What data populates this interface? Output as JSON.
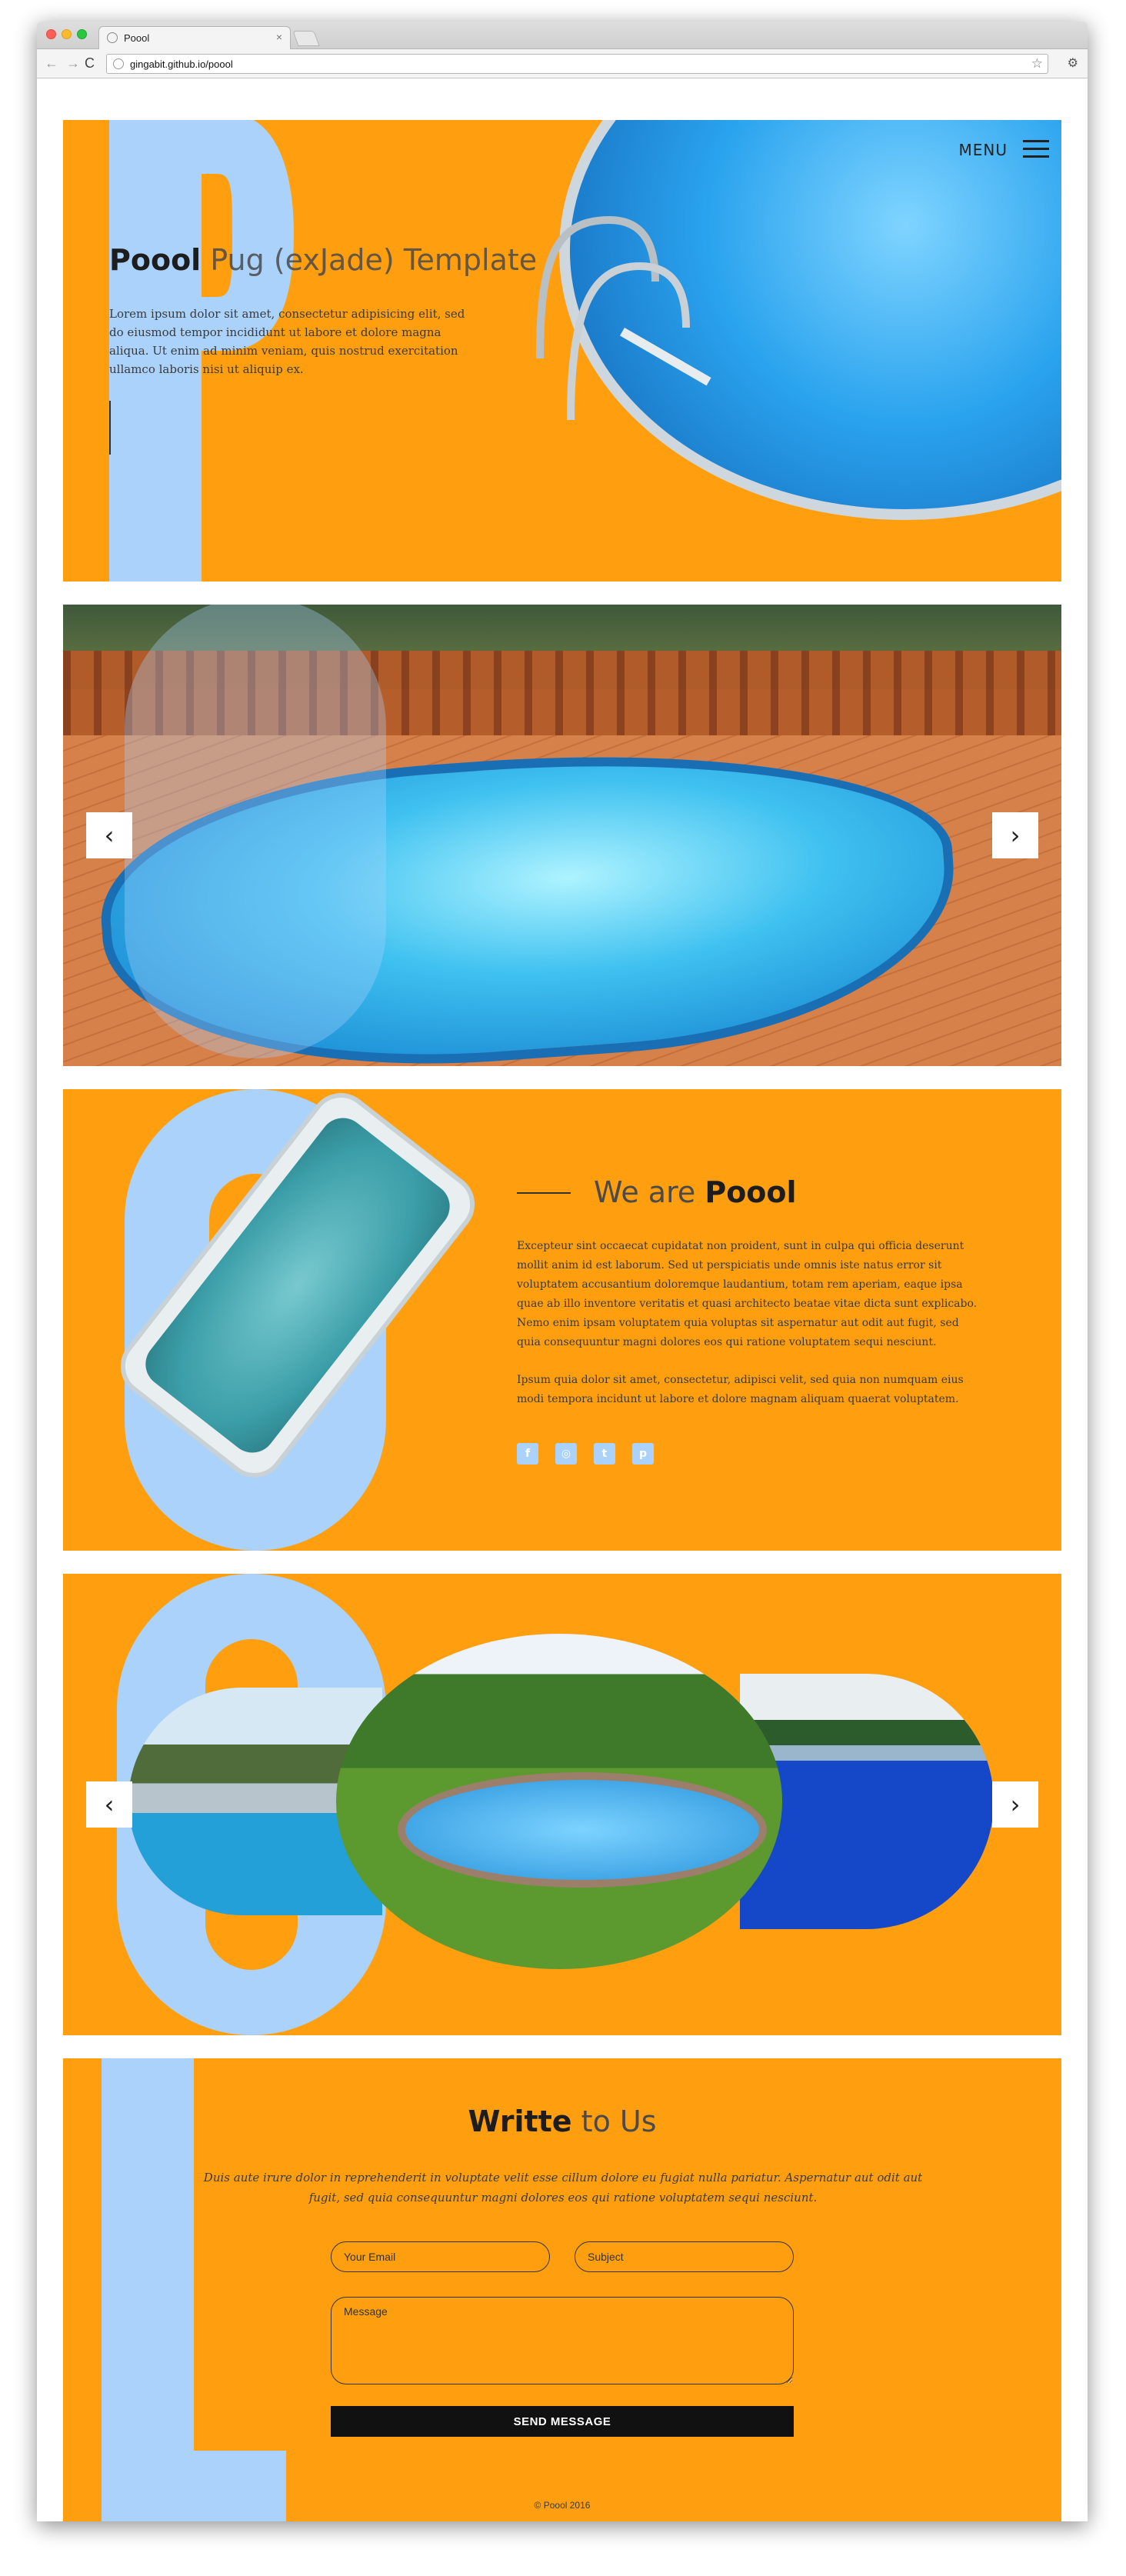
{
  "browser": {
    "tab_title": "Poool",
    "url": "gingabit.github.io/poool",
    "tab_close": "×",
    "nav": {
      "back": "←",
      "forward": "→",
      "reload": "C"
    },
    "star": "☆",
    "wrench": "🔧"
  },
  "hero": {
    "menu_label": "MENU",
    "big_letter": "P",
    "title_bold": "Poool",
    "title_light": " Pug (exJade) Template",
    "text": "Lorem ipsum dolor sit amet, consectetur adipisicing elit, sed do eiusmod tempor incididunt ut labore et dolore magna aliqua. Ut enim ad minim veniam, quis nostrud exercitation ullamco laboris nisi ut aliquip ex."
  },
  "slider": {
    "prev": "‹",
    "next": "›"
  },
  "about": {
    "title_light": "We are ",
    "title_bold": "Poool",
    "paragraph1": "Excepteur sint occaecat cupidatat non proident, sunt in culpa qui officia deserunt mollit anim id est laborum. Sed ut perspiciatis unde omnis iste natus error sit voluptatem accusantium doloremque laudantium, totam rem aperiam, eaque ipsa quae ab illo inventore veritatis et quasi architecto beatae vitae dicta sunt explicabo. Nemo enim ipsam voluptatem quia voluptas sit aspernatur aut odit aut fugit, sed quia consequuntur magni dolores eos qui ratione voluptatem sequi nesciunt.",
    "paragraph2": "Ipsum quia dolor sit amet, consectetur, adipisci velit, sed quia non numquam eius modi tempora incidunt ut labore et dolore magnam aliquam quaerat voluptatem.",
    "socials": [
      {
        "icon": "facebook-icon",
        "glyph": "f"
      },
      {
        "icon": "instagram-icon",
        "glyph": "◎"
      },
      {
        "icon": "twitter-icon",
        "glyph": "t"
      },
      {
        "icon": "pinterest-icon",
        "glyph": "p"
      }
    ]
  },
  "gallery": {
    "prev": "‹",
    "next": "›"
  },
  "contact": {
    "title_bold": "Writte",
    "title_light": " to Us",
    "text": "Duis aute irure dolor in reprehenderit in voluptate velit esse cillum dolore eu fugiat nulla pariatur. Aspernatur aut odit aut fugit, sed quia consequuntur magni dolores eos qui ratione voluptatem sequi nesciunt.",
    "email_placeholder": "Your Email",
    "subject_placeholder": "Subject",
    "message_placeholder": "Message",
    "send_label": "SEND MESSAGE",
    "footer": "© Poool 2016"
  },
  "colors": {
    "accent": "#ff9f10",
    "letter": "#aad2fb",
    "dark": "#111111"
  }
}
